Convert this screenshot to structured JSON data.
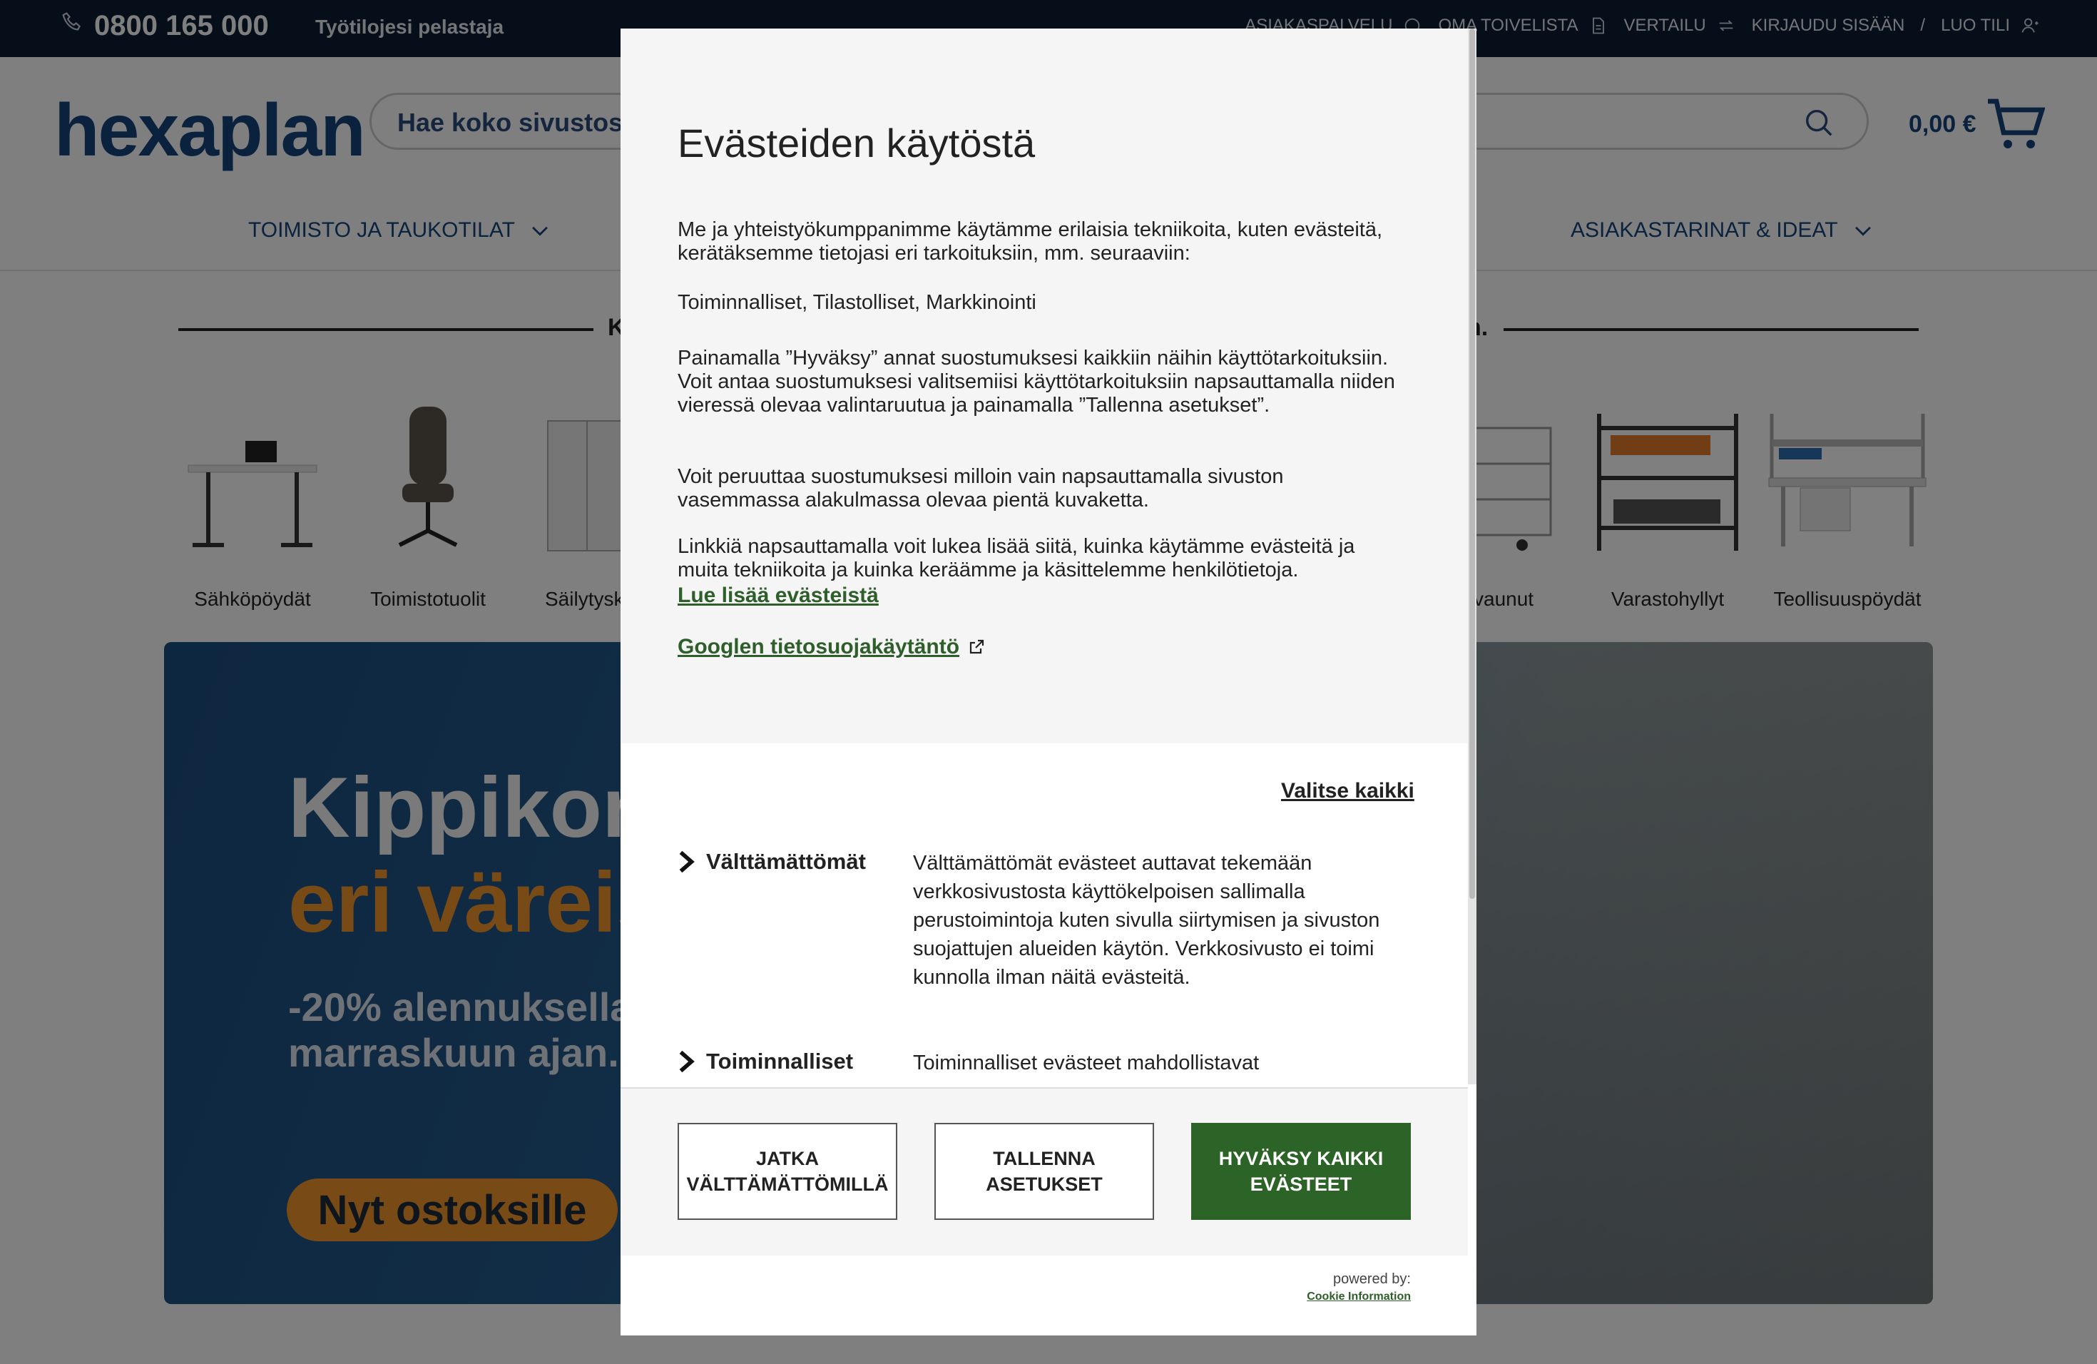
{
  "topbar": {
    "phone": "0800 165 000",
    "tagline": "Työtilojesi pelastaja",
    "links": [
      "ASIAKASPALVELU",
      "OMA TOIVELISTA",
      "VERTAILU",
      "KIRJAUDU SISÄÄN",
      "/",
      "LUO TILI"
    ]
  },
  "header": {
    "logo": "hexaplan",
    "search_placeholder": "Hae koko sivustost",
    "cart_total": "0,00 €",
    "nav_left": "TOIMISTO JA TAUKOTILAT",
    "nav_right": "ASIAKASTARINAT & IDEAT"
  },
  "categories": {
    "heading_left": "K",
    "heading_right": "n.",
    "items": [
      {
        "label": "Sähköpöydät"
      },
      {
        "label": "Toimistotuolit"
      },
      {
        "label": "Säilytysk"
      },
      {
        "label": "vaunut"
      },
      {
        "label": "Varastohyllyt"
      },
      {
        "label": "Teollisuuspöydät"
      }
    ]
  },
  "hero": {
    "title_line1": "Kippikon",
    "title_line2": "eri väreis",
    "subtitle": "-20% alennuksella marraskuun ajan.",
    "cta": "Nyt ostoksille",
    "colors": {
      "accent": "#f0952a",
      "bg": "#245a8d"
    }
  },
  "modal": {
    "title": "Evästeiden käytöstä",
    "intro": "Me ja yhteistyökumppanimme käytämme erilaisia tekniikoita, kuten evästeitä, kerätäksemme tietojasi eri tarkoituksiin, mm. seuraaviin:",
    "purposes": "Toiminnalliset, Tilastolliset, Markkinointi",
    "consent_text": "Painamalla ”Hyväksy” annat suostumuksesi kaikkiin näihin käyttötarkoituksiin. Voit antaa suostumuksesi valitsemiisi käyttötarkoituksiin napsauttamalla niiden vieressä olevaa valintaruutua ja painamalla ”Tallenna asetukset”.",
    "withdraw_text": "Voit peruuttaa suostumuksesi milloin vain napsauttamalla sivuston vasemmassa alakulmassa olevaa pientä kuvaketta.",
    "link_text": "Linkkiä napsauttamalla voit lukea lisää siitä, kuinka käytämme evästeitä ja muita tekniikoita ja kuinka keräämme ja käsittelemme henkilötietoja.",
    "read_more": "Lue lisää evästeistä",
    "google_policy": "Googlen tietosuojakäytäntö",
    "select_all": "Valitse kaikki",
    "categories": [
      {
        "name": "Välttämättömät",
        "desc": "Välttämättömät evästeet auttavat tekemään verkkosivustosta käyttökelpoisen sallimalla perustoimintoja kuten sivulla siirtymisen ja sivuston suojattujen alueiden käytön. Verkkosivusto ei toimi kunnolla ilman näitä evästeitä."
      },
      {
        "name": "Toiminnalliset",
        "desc": "Toiminnalliset evästeet mahdollistavat"
      }
    ],
    "buttons": {
      "necessary": "JATKA VÄLTTÄMÄTTÖMILLÄ",
      "save": "TALLENNA ASETUKSET",
      "accept": "HYVÄKSY KAIKKI EVÄSTEET"
    },
    "powered_by": "powered by:",
    "provider": "Cookie Information",
    "colors": {
      "primary": "#2c6326",
      "link": "#2e5e2a"
    }
  }
}
